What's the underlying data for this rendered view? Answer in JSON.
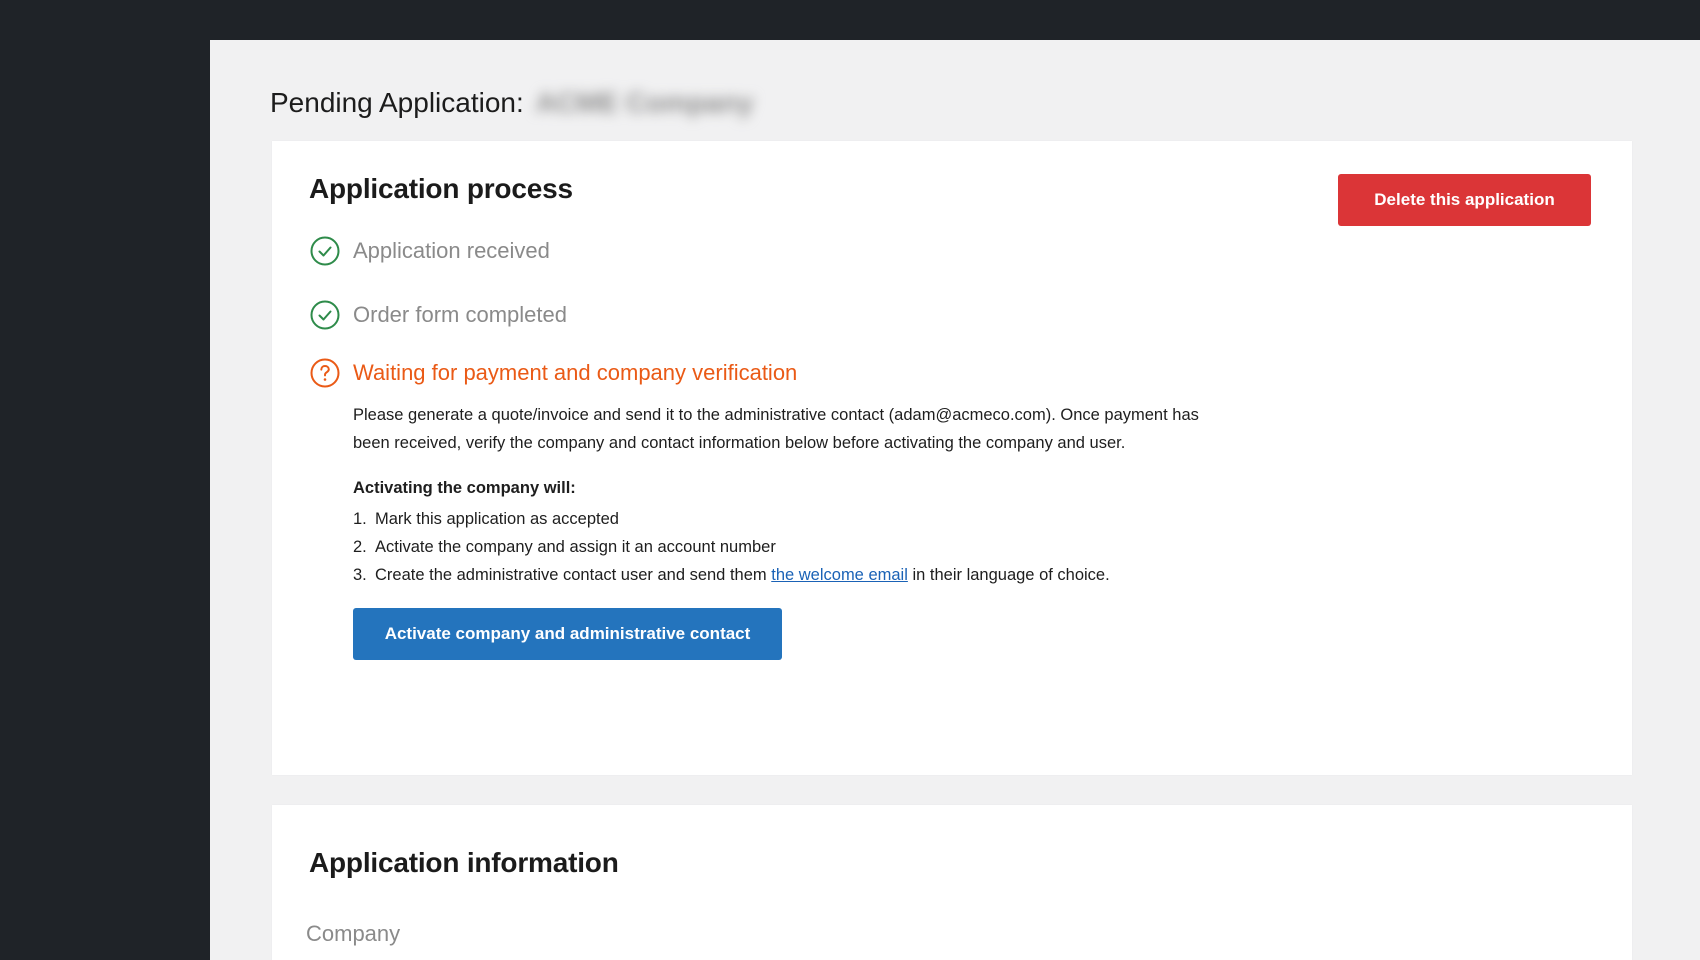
{
  "page": {
    "heading": "Pending Application:",
    "company_name": "ACME Company"
  },
  "process_card": {
    "title": "Application process",
    "delete_button": "Delete this application",
    "steps": [
      {
        "label": "Application received",
        "status": "complete",
        "icon": "check-circle-icon"
      },
      {
        "label": "Order form completed",
        "status": "complete",
        "icon": "check-circle-icon"
      },
      {
        "label": "Waiting for payment and company verification",
        "status": "pending",
        "icon": "question-circle-icon"
      }
    ],
    "instructions": "Please generate a quote/invoice and send it to the administrative contact (adam@acmeco.com). Once payment has been received, verify the company and contact information below before activating the company and user.",
    "activation_heading": "Activating the company will:",
    "activation_steps": [
      {
        "number": "1.",
        "text": "Mark this application as accepted"
      },
      {
        "number": "2.",
        "text": "Activate the company and assign it an account number"
      },
      {
        "number": "3.",
        "text_before": "Create the administrative contact user and send them",
        "link": "the welcome email",
        "text_after": "in their language of choice."
      }
    ],
    "activate_button": "Activate company and administrative contact"
  },
  "info_card": {
    "title": "Application information",
    "company_label": "Company"
  },
  "colors": {
    "sidebar": "#1f2328",
    "content_bg": "#f1f1f2",
    "success": "#2e8b4a",
    "warning": "#ea5a16",
    "danger": "#db3537",
    "primary": "#2474bd",
    "link": "#1a62b6"
  }
}
